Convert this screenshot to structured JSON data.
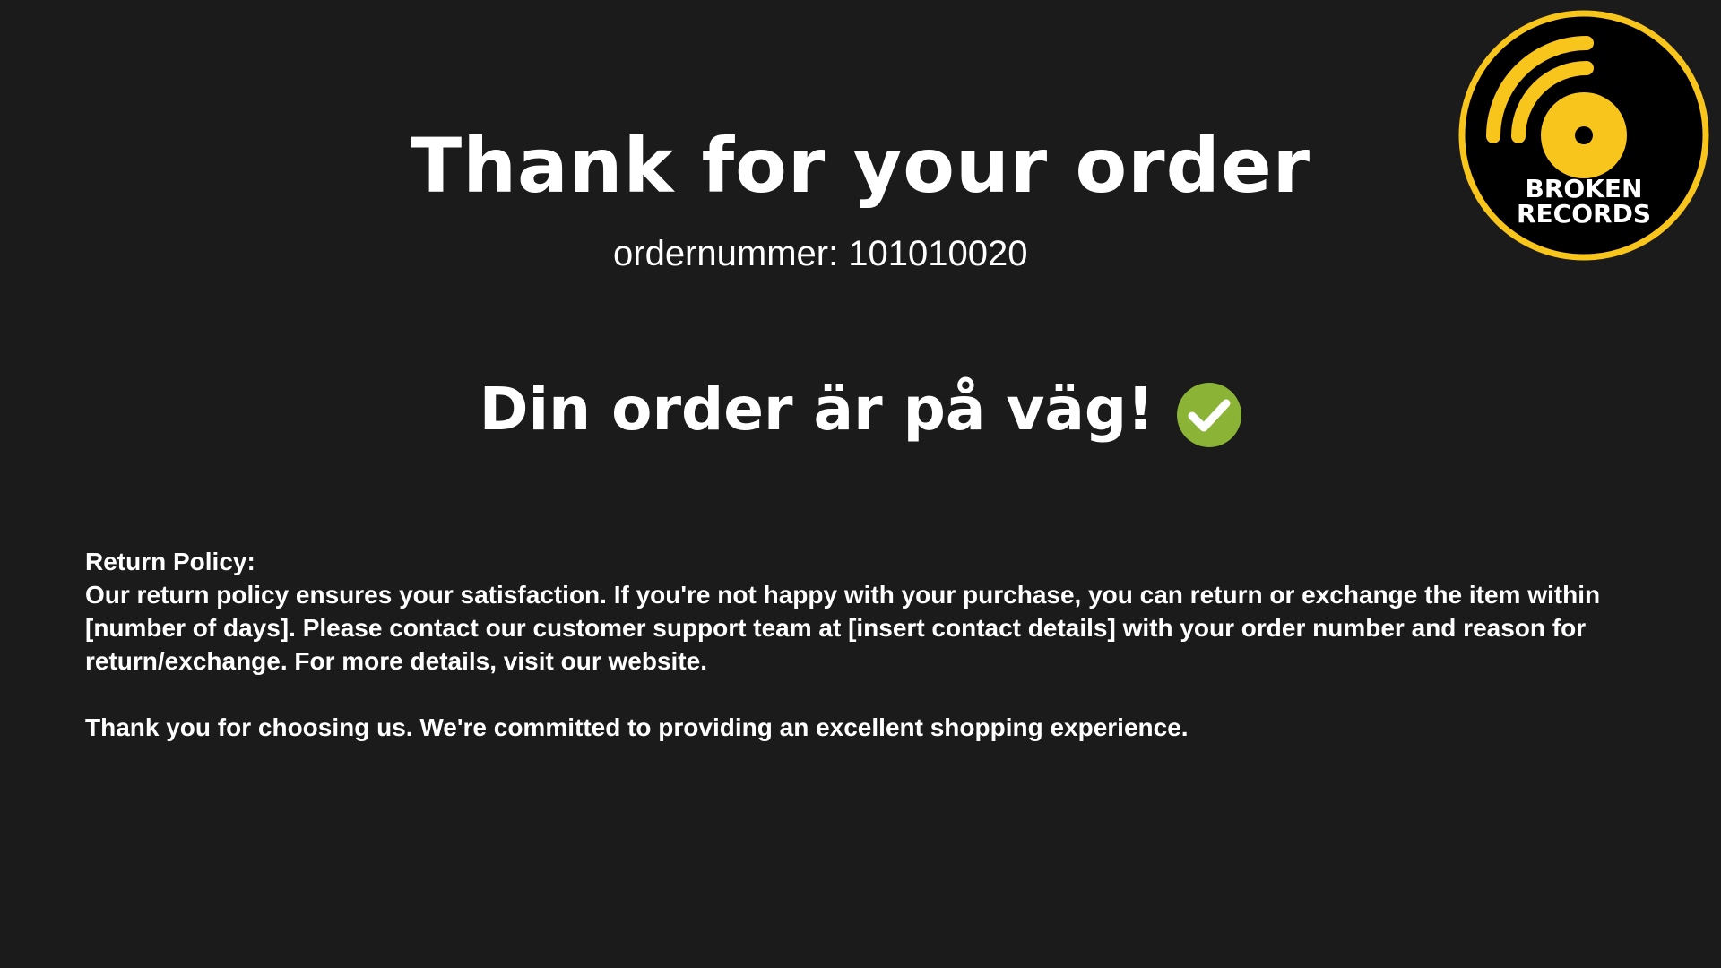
{
  "header": {
    "title": "Thank for your order",
    "order_number_label": "ordernummer: 101010020"
  },
  "status": {
    "text": "Din order är på väg!",
    "icon": "check-circle-icon",
    "icon_color": "#8bb437"
  },
  "policy": {
    "heading": "Return Policy:",
    "body": "Our return policy ensures your satisfaction. If you're not happy with your purchase, you can return or exchange the item within [number of days]. Please contact our customer support team at [insert contact details] with your order number and reason for return/exchange. For more details, visit our website.",
    "closing": "Thank you for choosing us. We're committed to providing an excellent shopping experience."
  },
  "logo": {
    "line1": "BROKEN",
    "line2": "RECORDS",
    "accent_color": "#f8c51c"
  },
  "colors": {
    "background": "#1b1b1b",
    "text": "#ffffff"
  }
}
